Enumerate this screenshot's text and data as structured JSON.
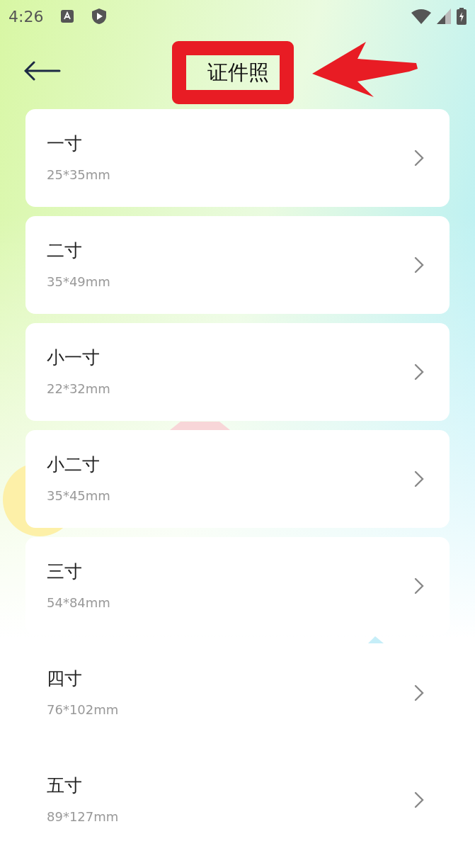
{
  "status_bar": {
    "time": "4:26"
  },
  "header": {
    "title": "证件照"
  },
  "items": [
    {
      "title": "一寸",
      "size": "25*35mm"
    },
    {
      "title": "二寸",
      "size": "35*49mm"
    },
    {
      "title": "小一寸",
      "size": "22*32mm"
    },
    {
      "title": "小二寸",
      "size": "35*45mm"
    },
    {
      "title": "三寸",
      "size": "54*84mm"
    },
    {
      "title": "四寸",
      "size": "76*102mm"
    },
    {
      "title": "五寸",
      "size": "89*127mm"
    }
  ]
}
